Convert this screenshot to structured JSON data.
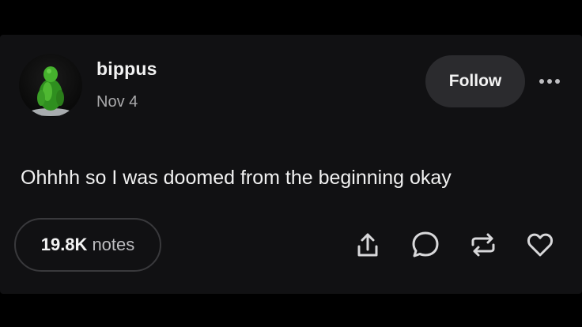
{
  "post": {
    "username": "bippus",
    "date": "Nov 4",
    "body": "Ohhhh so I was doomed from the beginning okay"
  },
  "header": {
    "follow_label": "Follow",
    "more_icon": "more-horizontal-icon"
  },
  "footer": {
    "notes_count": "19.8K",
    "notes_label": "notes",
    "actions": [
      {
        "name": "share",
        "icon": "share-icon"
      },
      {
        "name": "reply",
        "icon": "speech-bubble-icon"
      },
      {
        "name": "reblog",
        "icon": "reblog-icon"
      },
      {
        "name": "like",
        "icon": "heart-icon"
      }
    ]
  },
  "colors": {
    "background": "#000000",
    "card": "#111113",
    "follow_button": "#2b2b2e",
    "avatar_figure": "#3fa52a"
  }
}
